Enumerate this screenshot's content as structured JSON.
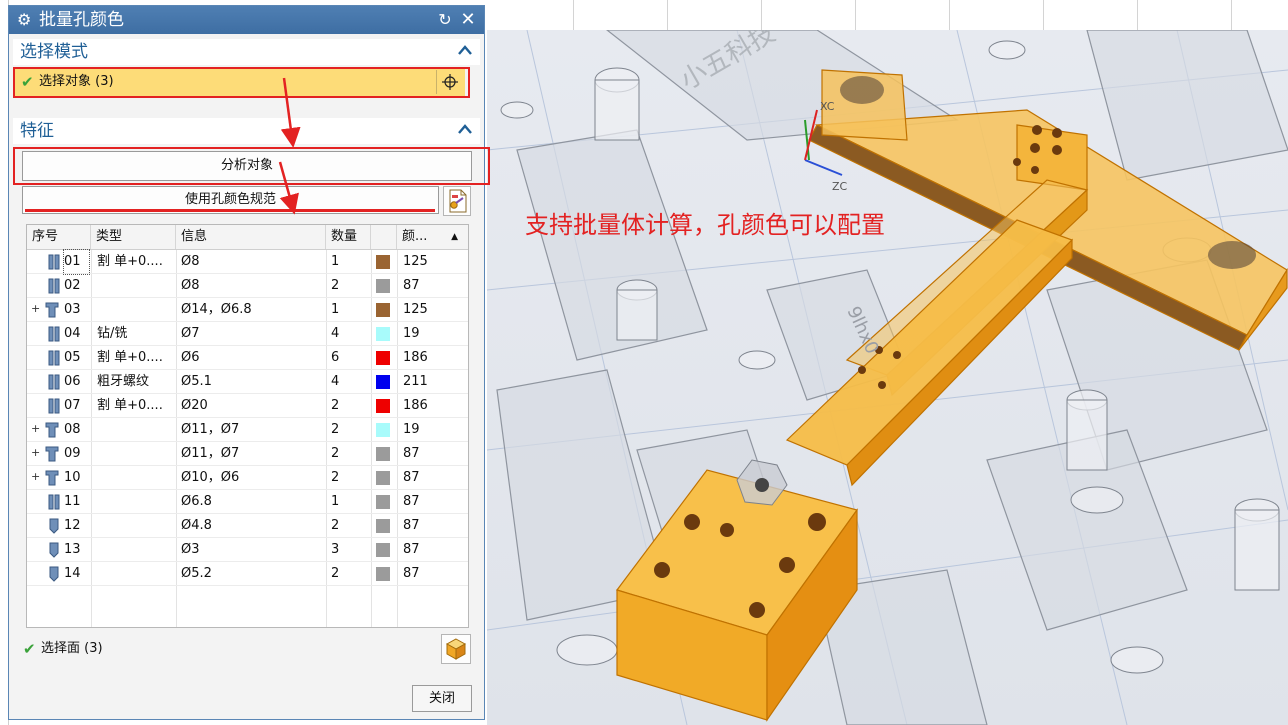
{
  "dialog": {
    "title": "批量孔颜色",
    "icons": {
      "settings": "gear-icon",
      "reset": "reset-icon",
      "close": "close-icon"
    }
  },
  "select_mode": {
    "header": "选择模式",
    "select_object_label": "选择对象 (3)"
  },
  "features": {
    "header": "特征",
    "analyze_button": "分析对象",
    "use_standard_button": "使用孔颜色规范"
  },
  "table": {
    "columns": [
      "序号",
      "类型",
      "信息",
      "数量",
      "颜..."
    ],
    "rows": [
      {
        "id": "01",
        "type": "割 单+0....",
        "info": "Ø8",
        "qty": "1",
        "color": "#9a6432",
        "color_value": "125",
        "expandable": false,
        "icon": "thread-hole-icon"
      },
      {
        "id": "02",
        "type": "",
        "info": "Ø8",
        "qty": "2",
        "color": "#9b9b9b",
        "color_value": "87",
        "expandable": false,
        "icon": "thread-hole-icon"
      },
      {
        "id": "03",
        "type": "",
        "info": "Ø14，Ø6.8",
        "qty": "1",
        "color": "#9a6432",
        "color_value": "125",
        "expandable": true,
        "icon": "counterbore-hole-icon"
      },
      {
        "id": "04",
        "type": "钻/铣",
        "info": "Ø7",
        "qty": "4",
        "color": "#a8fbfb",
        "color_value": "19",
        "expandable": false,
        "icon": "thread-hole-icon"
      },
      {
        "id": "05",
        "type": "割 单+0....",
        "info": "Ø6",
        "qty": "6",
        "color": "#ee0000",
        "color_value": "186",
        "expandable": false,
        "icon": "thread-hole-icon"
      },
      {
        "id": "06",
        "type": "粗牙螺纹",
        "info": "Ø5.1",
        "qty": "4",
        "color": "#0000ee",
        "color_value": "211",
        "expandable": false,
        "icon": "thread-hole-icon"
      },
      {
        "id": "07",
        "type": "割 单+0....",
        "info": "Ø20",
        "qty": "2",
        "color": "#ee0000",
        "color_value": "186",
        "expandable": false,
        "icon": "thread-hole-icon"
      },
      {
        "id": "08",
        "type": "",
        "info": "Ø11，Ø7",
        "qty": "2",
        "color": "#a8fbfb",
        "color_value": "19",
        "expandable": true,
        "icon": "counterbore-hole-icon"
      },
      {
        "id": "09",
        "type": "",
        "info": "Ø11，Ø7",
        "qty": "2",
        "color": "#9b9b9b",
        "color_value": "87",
        "expandable": true,
        "icon": "counterbore-hole-icon"
      },
      {
        "id": "10",
        "type": "",
        "info": "Ø10，Ø6",
        "qty": "2",
        "color": "#9b9b9b",
        "color_value": "87",
        "expandable": true,
        "icon": "counterbore-hole-icon"
      },
      {
        "id": "11",
        "type": "",
        "info": "Ø6.8",
        "qty": "1",
        "color": "#9b9b9b",
        "color_value": "87",
        "expandable": false,
        "icon": "thread-hole-icon"
      },
      {
        "id": "12",
        "type": "",
        "info": "Ø4.8",
        "qty": "2",
        "color": "#9b9b9b",
        "color_value": "87",
        "expandable": false,
        "icon": "blind-hole-icon"
      },
      {
        "id": "13",
        "type": "",
        "info": "Ø3",
        "qty": "3",
        "color": "#9b9b9b",
        "color_value": "87",
        "expandable": false,
        "icon": "blind-hole-icon"
      },
      {
        "id": "14",
        "type": "",
        "info": "Ø5.2",
        "qty": "2",
        "color": "#9b9b9b",
        "color_value": "87",
        "expandable": false,
        "icon": "blind-hole-icon"
      }
    ]
  },
  "select_face_label": "选择面 (3)",
  "close_button": "关闭",
  "viewport": {
    "annotation": "支持批量体计算，孔颜色可以配置",
    "axis_labels": {
      "x": "XC",
      "z": "ZC"
    },
    "engraving_1": "小五科技",
    "engraving_2": "9lhx0"
  },
  "accent_colors": {
    "title_bar": "#4a7aad",
    "highlight": "#fddc78",
    "annotation": "#e32222",
    "part": "#f5b73a"
  }
}
